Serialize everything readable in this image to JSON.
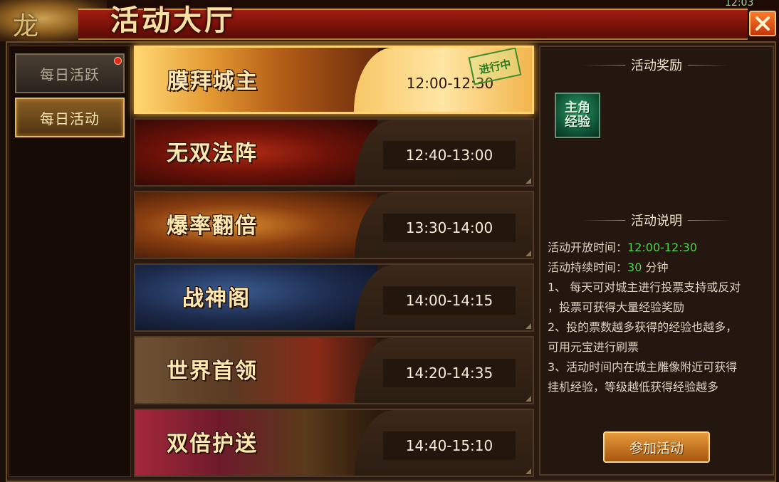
{
  "window": {
    "title": "活动大厅",
    "clock": "12:03",
    "close_icon": "close-icon"
  },
  "tabs": [
    {
      "label": "每日活跃",
      "active": false,
      "has_red_dot": true
    },
    {
      "label": "每日活动",
      "active": true,
      "has_red_dot": false
    }
  ],
  "activities": [
    {
      "name": "膜拜城主",
      "time": "12:00-12:30",
      "active": true,
      "status_stamp": "进行中"
    },
    {
      "name": "无双法阵",
      "time": "12:40-13:00",
      "active": false
    },
    {
      "name": "爆率翻倍",
      "time": "13:30-14:00",
      "active": false
    },
    {
      "name": "战神阁",
      "time": "14:00-14:15",
      "active": false
    },
    {
      "name": "世界首领",
      "time": "14:20-14:35",
      "active": false
    },
    {
      "name": "双倍护送",
      "time": "14:40-15:10",
      "active": false
    }
  ],
  "reward": {
    "heading": "活动奖励",
    "item_line1": "主角",
    "item_line2": "经验"
  },
  "description": {
    "heading": "活动说明",
    "open_time_label": "活动开放时间：",
    "open_time_value": "12:00-12:30",
    "duration_label": "活动持续时间：",
    "duration_value": "30",
    "duration_unit": " 分钟",
    "rules": [
      "1、 每天可对城主进行投票支持或反对",
      "，投票可获得大量经验奖励",
      "2、投的票数越多获得的经验也越多，",
      "可用元宝进行刷票",
      "3、活动时间内在城主雕像附近可获得",
      "挂机经验，等级越低获得经验越多"
    ]
  },
  "join_button": {
    "label": "参加活动"
  },
  "colors": {
    "title_red": "#8a160b",
    "gold_border": "#e3b661",
    "highlight_green": "#55d14c",
    "active_row_glow": "#ffd36b"
  }
}
